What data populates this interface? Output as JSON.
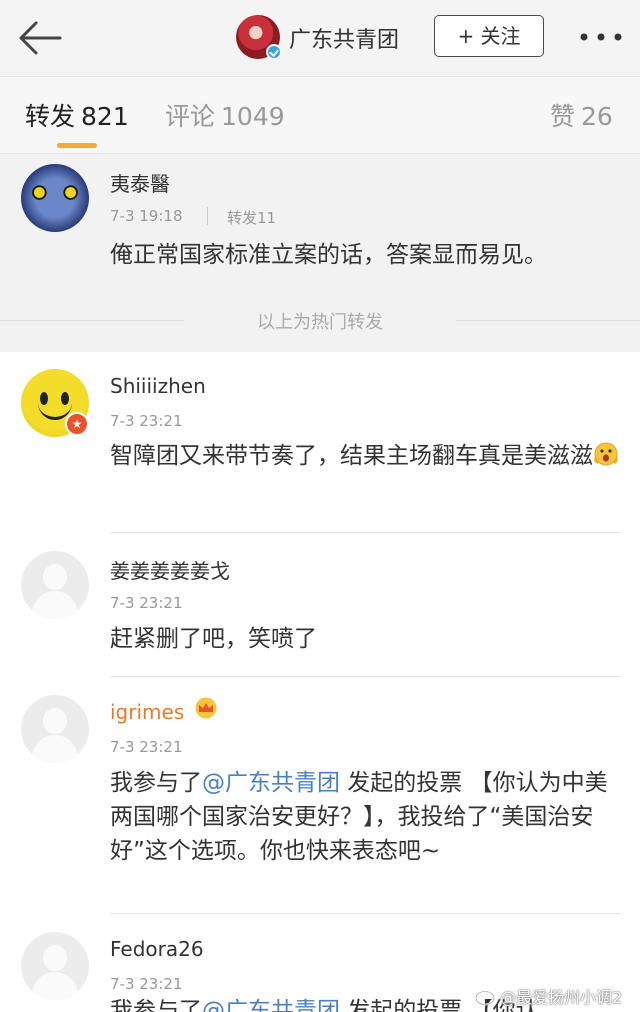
{
  "header": {
    "account_name": "广东共青团",
    "follow_label": "+ 关注",
    "icons": {
      "back": "back-arrow-icon",
      "more": "more-dots-icon",
      "verified": "verified-badge-icon"
    }
  },
  "tabs": {
    "repost": {
      "label": "转发",
      "count": "821"
    },
    "comment": {
      "label": "评论",
      "count": "1049"
    },
    "like": {
      "label": "赞",
      "count": "26"
    },
    "accent_color": "#f7a830"
  },
  "hot_repost": {
    "user": "夷泰醫",
    "time": "7-3 19:18",
    "repost_count": "转发11",
    "text": "俺正常国家标准立案的话，答案显而易见。"
  },
  "hot_divider": "以上为热门转发",
  "comments": [
    {
      "user": "Shiiiizhen",
      "time": "7-3 23:21",
      "text": "智障团又来带节奏了，结果主场翻车真是美滋滋"
    },
    {
      "user": "姜姜姜姜姜戈",
      "time": "7-3 23:21",
      "text": "赶紧删了吧，笑喷了"
    },
    {
      "user": "igrimes",
      "time": "7-3 23:21",
      "text_before": "我参与了",
      "mention": "@广东共青团",
      "text_after": " 发起的投票 【你认为中美两国哪个国家治安更好？】，我投给了“美国治安好”这个选项。你也快来表态吧~",
      "user_color": "#e87a2a"
    },
    {
      "user": "Fedora26",
      "time": "7-3 23:21"
    }
  ],
  "cut_text": {
    "before": "我参与了",
    "mention": "@广东共青团",
    "after": " 发起的投票 【你认"
  },
  "watermark": "@最爱扬州小调2"
}
